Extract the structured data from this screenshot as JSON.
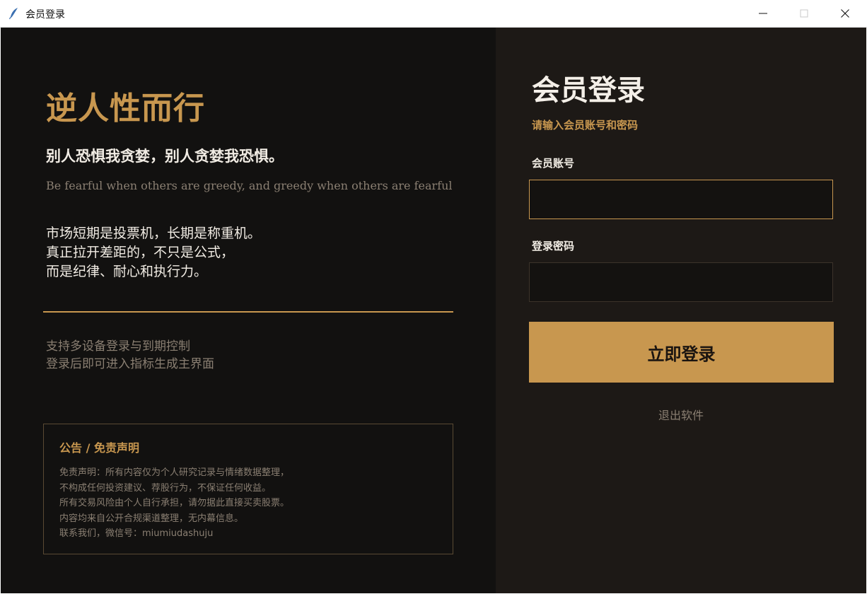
{
  "window": {
    "title": "会员登录"
  },
  "left": {
    "title": "逆人性而行",
    "quote_cn": "别人恐惧我贪婪，别人贪婪我恐惧。",
    "quote_en": "Be fearful when others are greedy, and greedy when others are fearful",
    "description": [
      "市场短期是投票机，长期是称重机。",
      "真正拉开差距的，不只是公式，",
      "而是纪律、耐心和执行力。"
    ],
    "features": [
      "支持多设备登录与到期控制",
      "登录后即可进入指标生成主界面"
    ],
    "notice": {
      "title": "公告 / 免责声明",
      "lines": [
        "免责声明：所有内容仅为个人研究记录与情绪数据整理，",
        "不构成任何投资建议、荐股行为，不保证任何收益。",
        "所有交易风险由个人自行承担，请勿据此直接买卖股票。",
        "内容均来自公开合规渠道整理，无内幕信息。",
        "联系我们，微信号：miumiudashuju"
      ]
    }
  },
  "login": {
    "title": "会员登录",
    "subtitle": "请输入会员账号和密码",
    "account_label": "会员账号",
    "account_value": "",
    "password_label": "登录密码",
    "password_value": "",
    "submit_label": "立即登录",
    "exit_label": "退出软件"
  },
  "colors": {
    "accent": "#c8974f",
    "left_bg": "#121110",
    "right_bg": "#1d1916",
    "muted_text": "#8a7f72",
    "light_text": "#f1ece4"
  },
  "icons": {
    "app": "feather-icon",
    "minimize": "minimize-icon",
    "maximize": "maximize-icon",
    "close": "close-icon"
  }
}
